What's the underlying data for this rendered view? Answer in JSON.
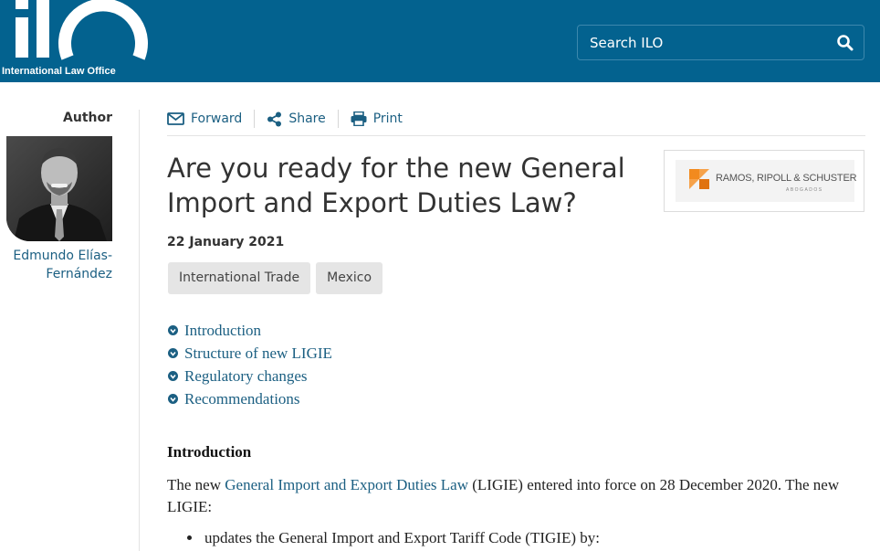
{
  "header": {
    "logo_text": "International Law Office",
    "search_placeholder": "Search ILO"
  },
  "author": {
    "heading": "Author",
    "name_line1": "Edmundo Elías-",
    "name_line2": "Fernández"
  },
  "toolbar": {
    "forward": "Forward",
    "share": "Share",
    "print": "Print"
  },
  "article": {
    "title_line1": "Are you ready for the new General",
    "title_line2": "Import and Export Duties Law?",
    "date": "22 January 2021",
    "tags": [
      "International Trade",
      "Mexico"
    ],
    "firm_name": "RAMOS, RIPOLL & SCHUSTER",
    "firm_sub": "ABOGADOS"
  },
  "toc": [
    "Introduction",
    "Structure of new LIGIE",
    "Regulatory changes",
    "Recommendations"
  ],
  "content": {
    "section_heading": "Introduction",
    "para_before": "The new ",
    "para_link": "General Import and Export Duties Law",
    "para_after": " (LIGIE) entered into force on 28 December 2020. The new LIGIE:",
    "bullet1": "updates the General Import and Export Tariff Code (TIGIE) by:"
  },
  "colors": {
    "header_bg": "#03628f",
    "link": "#1b5f82",
    "tag_bg": "#e5e5e5"
  }
}
